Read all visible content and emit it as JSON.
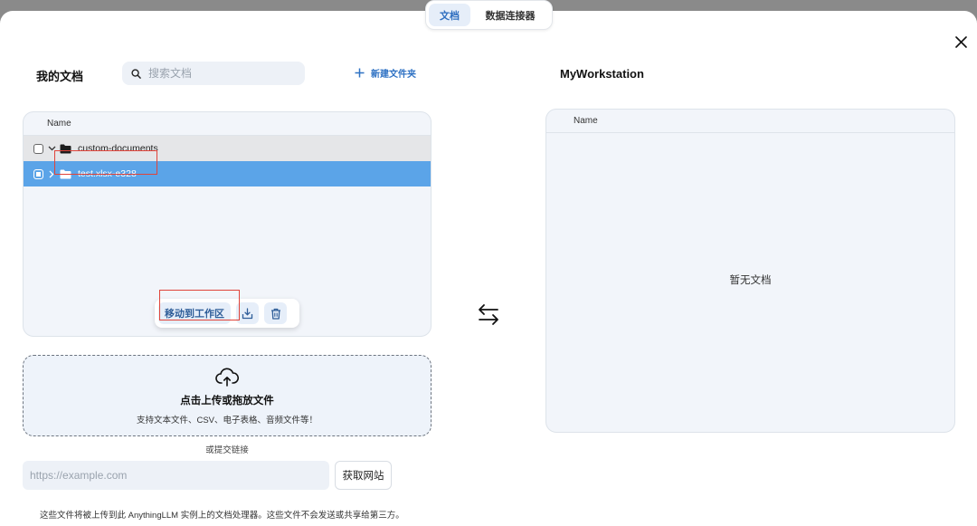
{
  "tabs": [
    {
      "label": "文档",
      "active": true
    },
    {
      "label": "数据连接器",
      "active": false
    }
  ],
  "left": {
    "title": "我的文档",
    "search_placeholder": "搜索文档",
    "new_folder_label": "新建文件夹",
    "column_header": "Name",
    "rows": [
      {
        "name": "custom-documents",
        "expanded": true,
        "selected": false
      },
      {
        "name": "test.xlsx-e328",
        "expanded": false,
        "selected": true
      }
    ],
    "move_button_label": "移动到工作区"
  },
  "upload": {
    "title": "点击上传或拖放文件",
    "subtitle": "支持文本文件、CSV、电子表格、音频文件等！",
    "or_link_label": "或提交链接",
    "url_placeholder": "https://example.com",
    "fetch_button_label": "获取网站",
    "footer_note": "这些文件将被上传到此 AnythingLLM 实例上的文档处理器。这些文件不会发送或共享给第三方。"
  },
  "right": {
    "title": "MyWorkstation",
    "column_header": "Name",
    "empty_text": "暂无文档"
  },
  "colors": {
    "accent": "#2f72c4",
    "selected_row": "#5ba4e8",
    "highlight_box": "#e0443a",
    "panel_bg": "#f2f5fa"
  }
}
